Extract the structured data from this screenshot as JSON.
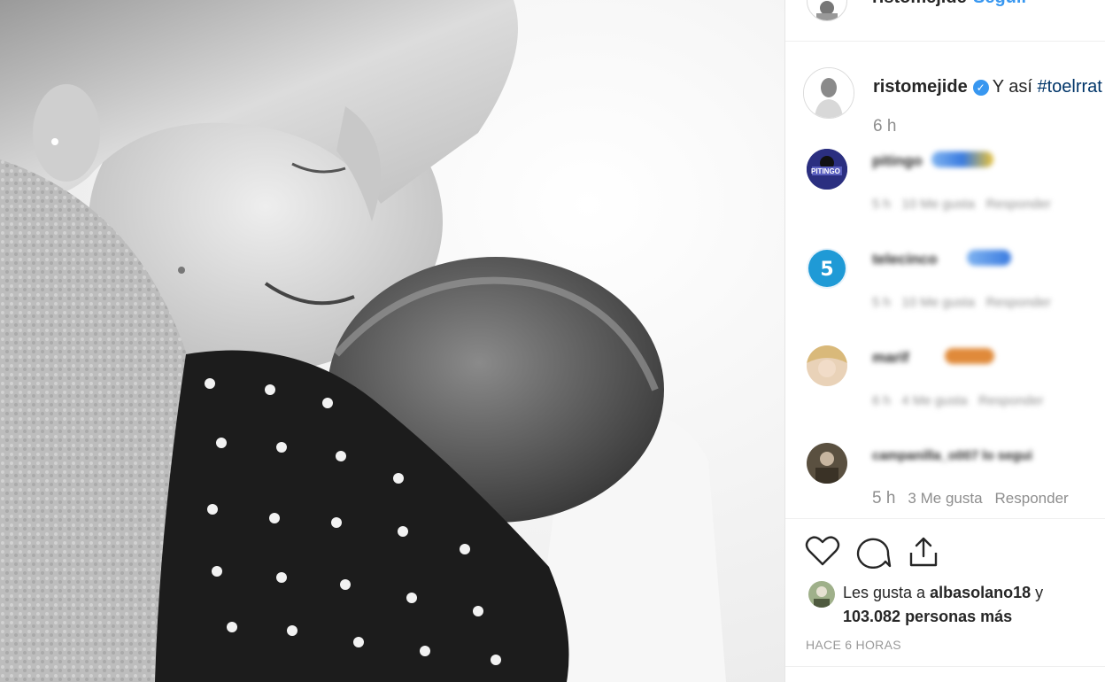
{
  "header": {
    "username": "ristomejide",
    "follow_label": "Seguir"
  },
  "caption": {
    "username": "ristomejide",
    "verified_icon": "verified-badge-icon",
    "text": "Y así",
    "hashtag": "#toelrrat",
    "time": "6 h"
  },
  "comments": [
    {
      "avatar_label": "PITINGO",
      "username": "pitingo",
      "time": "5 h",
      "likes": "10 Me gusta",
      "reply": "Responder"
    },
    {
      "username": "telecinco",
      "time": "5 h",
      "likes": "10 Me gusta",
      "reply": "Responder"
    },
    {
      "username": "marif",
      "time": "6 h",
      "likes": "4 Me gusta",
      "reply": "Responder"
    },
    {
      "username": "campanilla_o007 lo segui",
      "time": "5 h",
      "likes": "3 Me gusta",
      "reply": "Responder"
    }
  ],
  "actions": {
    "like_icon": "heart-icon",
    "comment_icon": "comment-icon",
    "share_icon": "share-icon"
  },
  "likes": {
    "prefix": "Les gusta a",
    "user": "albasolano18",
    "connector": "y",
    "count": "103.082 personas más"
  },
  "posted": "HACE 6 HORAS",
  "colors": {
    "link": "#3897f0",
    "text": "#262626",
    "muted": "#8e8e8e",
    "hashtag": "#003569"
  }
}
